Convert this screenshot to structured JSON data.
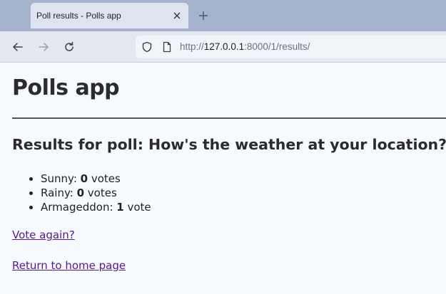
{
  "browser": {
    "tab_title": "Poll results - Polls app",
    "url": {
      "scheme": "http://",
      "host": "127.0.0.1",
      "rest": ":8000/1/results/"
    }
  },
  "page": {
    "title": "Polls app",
    "heading": "Results for poll: How's the weather at your location?",
    "results": [
      {
        "choice": "Sunny: ",
        "votes": "0",
        "unit": " votes"
      },
      {
        "choice": "Rainy: ",
        "votes": "0",
        "unit": " votes"
      },
      {
        "choice": "Armageddon: ",
        "votes": "1",
        "unit": " vote"
      }
    ],
    "vote_again_label": "Vote again?",
    "home_label": "Return to home page"
  },
  "icons": {
    "tab_close": "close-icon",
    "new_tab": "plus-icon",
    "back": "back-arrow-icon",
    "forward": "forward-arrow-icon",
    "reload": "reload-icon",
    "shield": "shield-icon",
    "page": "page-icon"
  },
  "colors": {
    "tabstrip": "#a5b4cc",
    "active_tab": "#dde4ef",
    "toolbar": "#e3e8f1",
    "link_visited": "#551a8b"
  }
}
